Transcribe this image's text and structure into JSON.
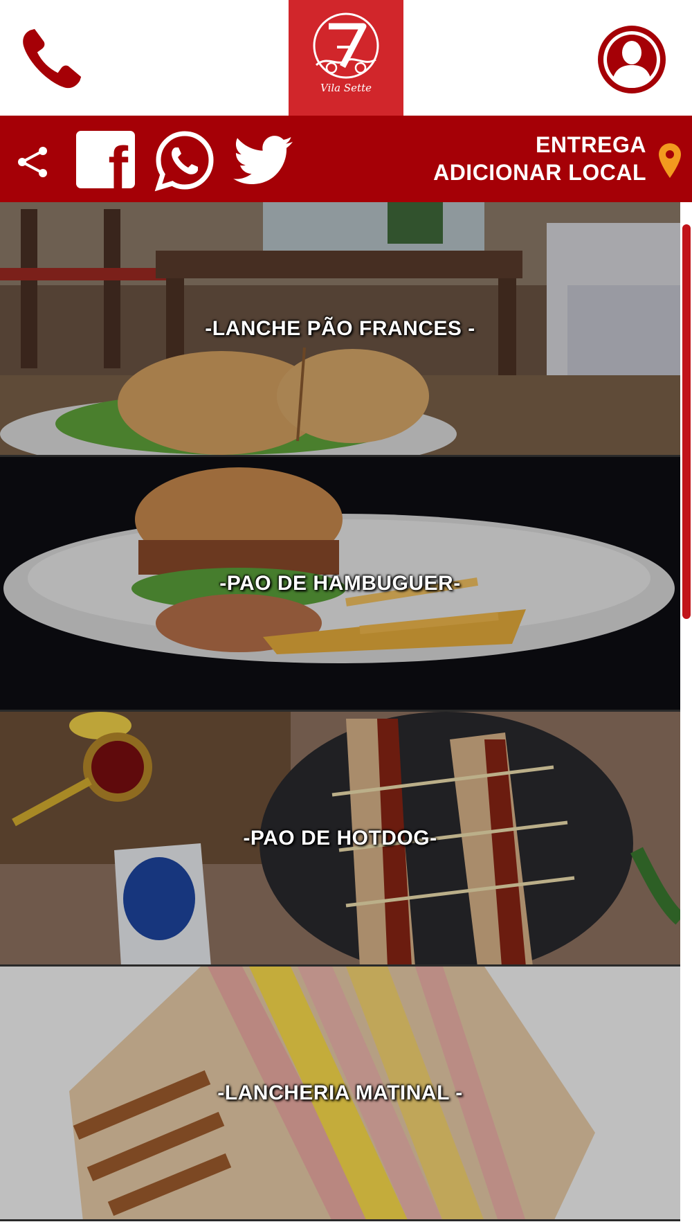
{
  "colors": {
    "accent_red": "#a50006",
    "logo_red": "#d1262b",
    "pin_orange": "#f29a1f"
  },
  "header": {
    "phone_icon": "phone-icon",
    "logo": {
      "brand_text": "Vila Sette",
      "brand_number": "7"
    },
    "user_icon": "user-icon"
  },
  "social_bar": {
    "share_icon": "share-icon",
    "facebook_icon": "facebook-icon",
    "facebook_glyph": "f",
    "whatsapp_icon": "whatsapp-icon",
    "twitter_icon": "twitter-icon",
    "delivery_title": "ENTREGA",
    "delivery_action": "ADICIONAR LOCAL",
    "location_icon": "location-pin-icon"
  },
  "categories": [
    {
      "label": "-LANCHE PÃO FRANCES -"
    },
    {
      "label": "-PAO DE HAMBUGUER-"
    },
    {
      "label": "-PAO DE HOTDOG-"
    },
    {
      "label": "-LANCHERIA MATINAL -"
    }
  ]
}
